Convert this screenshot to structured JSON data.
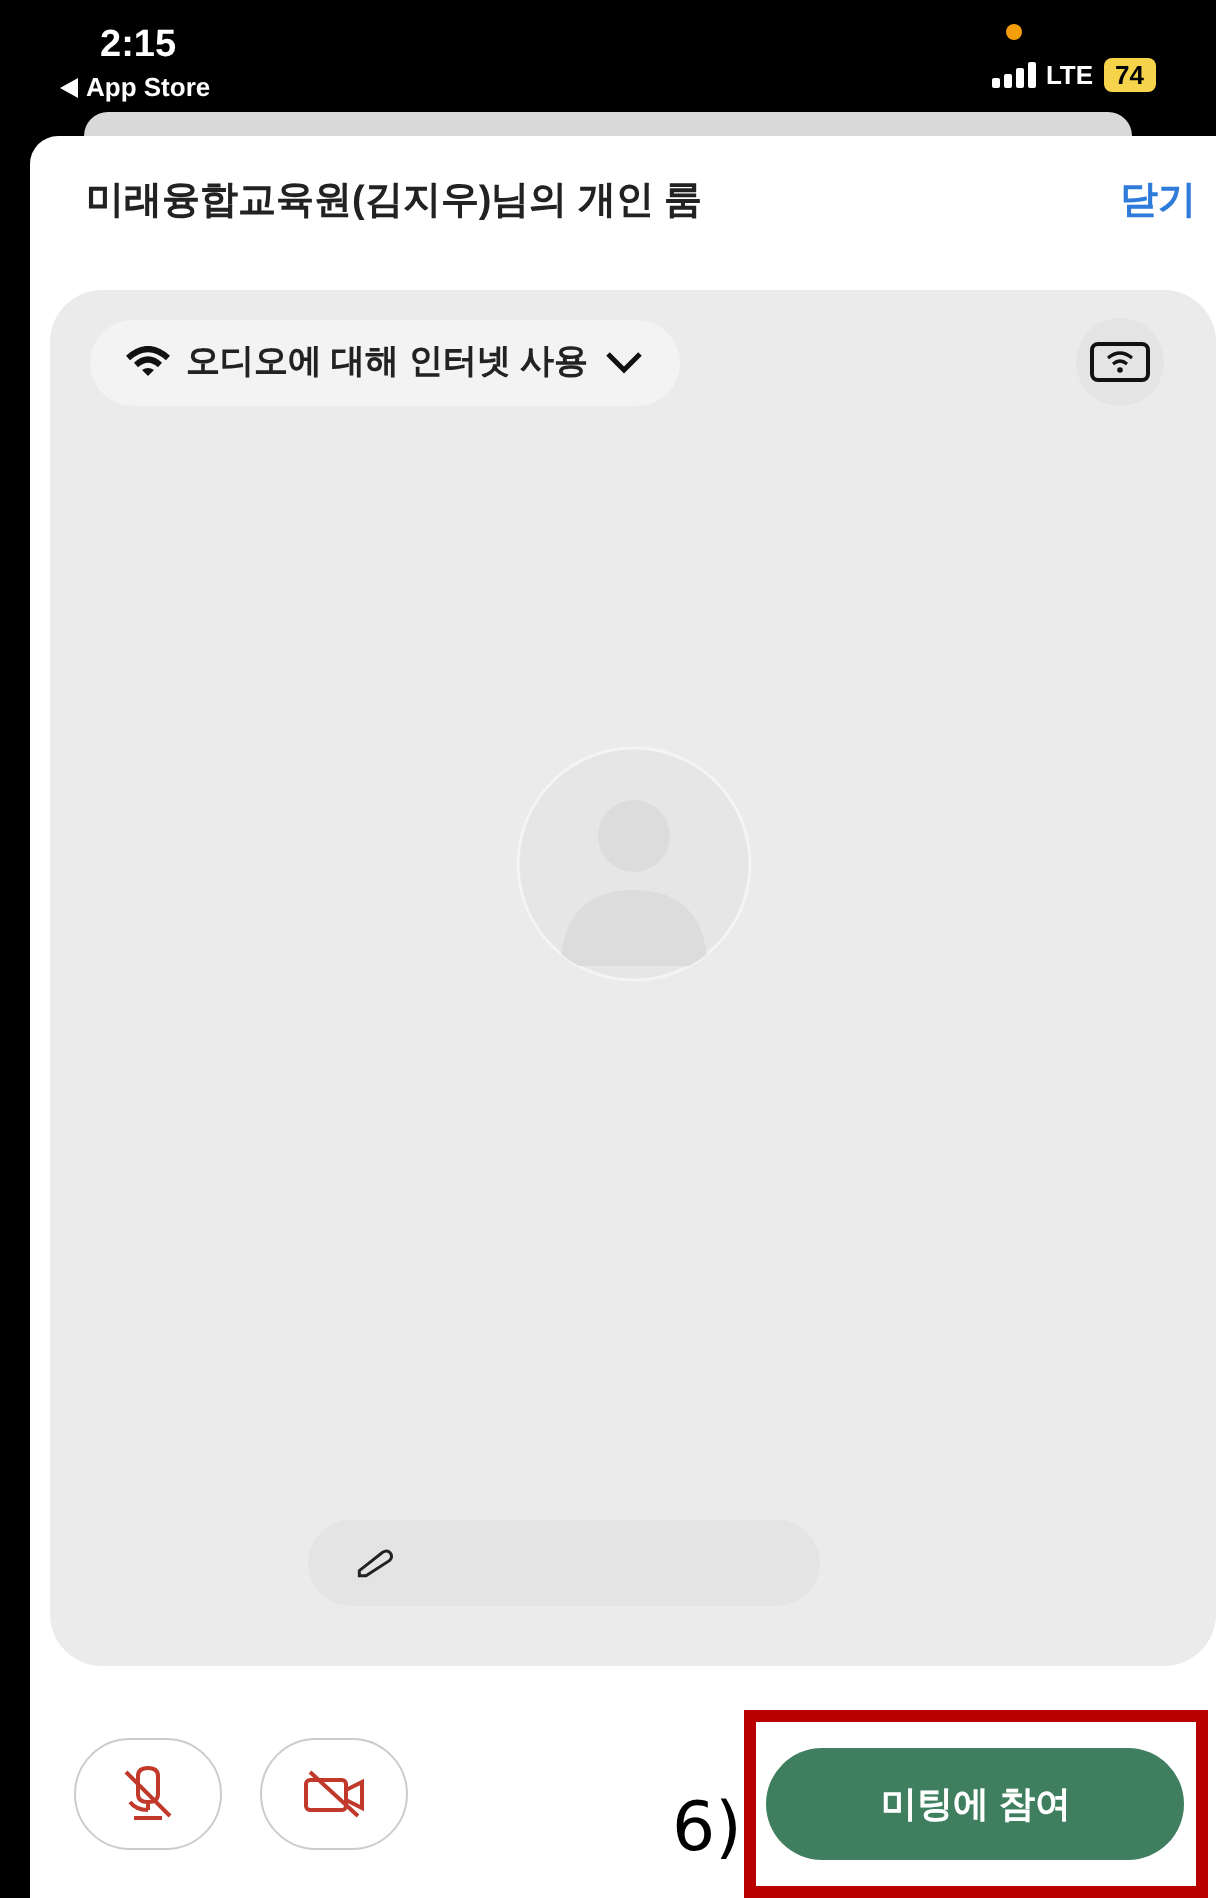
{
  "status_bar": {
    "time": "2:15",
    "back_label": "App Store",
    "network": "LTE",
    "battery": "74",
    "mic_in_use": true
  },
  "sheet": {
    "title": "미래융합교육원(김지우)님의 개인 룸",
    "close_label": "닫기"
  },
  "preview": {
    "audio_option": "오디오에 대해 인터넷 사용"
  },
  "controls": {
    "mic_muted": true,
    "camera_off": true,
    "join_label": "미팅에 참여"
  },
  "annotation": {
    "label": "6)"
  }
}
